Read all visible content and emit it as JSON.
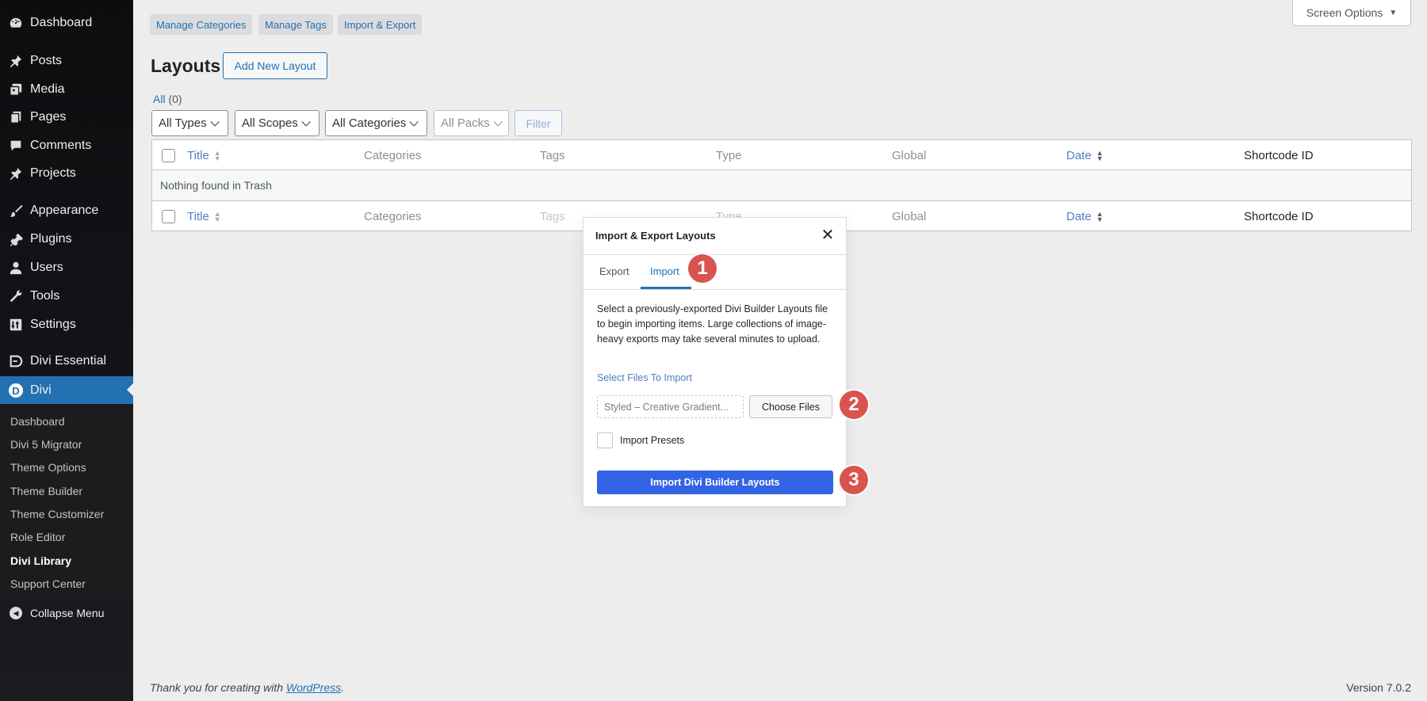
{
  "sidebar": {
    "items": [
      {
        "label": "Dashboard",
        "icon": "dashboard-icon"
      },
      {
        "label": "Posts",
        "icon": "pin-icon"
      },
      {
        "label": "Media",
        "icon": "media-icon"
      },
      {
        "label": "Pages",
        "icon": "pages-icon"
      },
      {
        "label": "Comments",
        "icon": "comment-icon"
      },
      {
        "label": "Projects",
        "icon": "pin-icon"
      },
      {
        "label": "Appearance",
        "icon": "brush-icon"
      },
      {
        "label": "Plugins",
        "icon": "plug-icon"
      },
      {
        "label": "Users",
        "icon": "user-icon"
      },
      {
        "label": "Tools",
        "icon": "wrench-icon"
      },
      {
        "label": "Settings",
        "icon": "settings-icon"
      },
      {
        "label": "Divi Essential",
        "icon": "divi-essential-icon"
      },
      {
        "label": "Divi",
        "icon": "divi-logo-icon",
        "active": true
      }
    ],
    "submenu": [
      {
        "label": "Dashboard"
      },
      {
        "label": "Divi 5 Migrator"
      },
      {
        "label": "Theme Options"
      },
      {
        "label": "Theme Builder"
      },
      {
        "label": "Theme Customizer"
      },
      {
        "label": "Role Editor"
      },
      {
        "label": "Divi Library",
        "current": true
      },
      {
        "label": "Support Center"
      }
    ],
    "collapse_label": "Collapse Menu"
  },
  "top_links": [
    "Manage Categories",
    "Manage Tags",
    "Import & Export"
  ],
  "screen_options": "Screen Options",
  "screen_options_arrow": "▼",
  "page": {
    "title": "Layouts",
    "add_new": "Add New Layout",
    "all_label": "All",
    "all_count": "(0)"
  },
  "filters": {
    "types": "All Types",
    "scopes": "All Scopes",
    "categories": "All Categories",
    "packs": "All Packs",
    "button": "Filter"
  },
  "table": {
    "columns": {
      "title": "Title",
      "categories": "Categories",
      "tags": "Tags",
      "type": "Type",
      "global": "Global",
      "date": "Date",
      "shortcode": "Shortcode ID"
    },
    "empty_message": "Nothing found in Trash"
  },
  "modal": {
    "title": "Import & Export Layouts",
    "close": "✕",
    "tabs": {
      "export": "Export",
      "import": "Import"
    },
    "description": "Select a previously-exported Divi Builder Layouts file to begin importing items. Large collections of image-heavy exports may take several minutes to upload.",
    "select_label": "Select Files To Import",
    "file_value": "Styled – Creative Gradient...",
    "choose_files": "Choose Files",
    "presets_label": "Import Presets",
    "import_button": "Import Divi Builder Layouts"
  },
  "steps": [
    "1",
    "2",
    "3"
  ],
  "footer": {
    "thanks_prefix": "Thank you for creating with ",
    "wordpress_link": "WordPress",
    "thanks_suffix": ".",
    "version": "Version 7.0.2"
  },
  "colors": {
    "accent": "#2271b1",
    "import_button": "#3364e6",
    "step_badge": "#d9534f",
    "sidebar_bg": "#121317"
  }
}
